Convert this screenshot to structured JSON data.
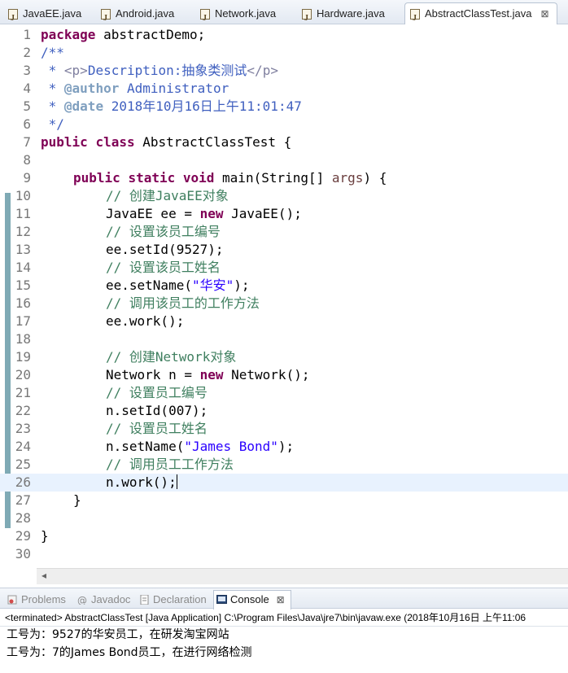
{
  "editor_tabs": [
    {
      "label": "JavaEE.java"
    },
    {
      "label": "Android.java"
    },
    {
      "label": "Network.java"
    },
    {
      "label": "Hardware.java"
    },
    {
      "label": "AbstractClassTest.java",
      "active": true
    }
  ],
  "close_glyph": "⊠",
  "code_lines": [
    "1",
    "2",
    "3",
    "4",
    "5",
    "6",
    "7",
    "8",
    "9",
    "10",
    "11",
    "12",
    "13",
    "14",
    "15",
    "16",
    "17",
    "18",
    "19",
    "20",
    "21",
    "22",
    "23",
    "24",
    "25",
    "26",
    "27",
    "28",
    "29",
    "30"
  ],
  "code": {
    "l1_kw": "package",
    "l1_rest": " abstractDemo;",
    "l2": "/**",
    "l3_pre": " * ",
    "l3_tag_open": "<p>",
    "l3_text": "Description:抽象类测试",
    "l3_tag_close": "</p>",
    "l4_pre": " * ",
    "l4_an": "@author",
    "l4_text": " Administrator",
    "l5_pre": " * ",
    "l5_an": "@date",
    "l5_text": " 2018年10月16日上午11:01:47",
    "l6": " */",
    "l7_kw1": "public",
    "l7_kw2": "class",
    "l7_rest": " AbstractClassTest {",
    "l9_kw1": "public",
    "l9_kw2": "static",
    "l9_kw3": "void",
    "l9_rest1": " main(String[] ",
    "l9_par": "args",
    "l9_rest2": ") {",
    "l10": "// 创建JavaEE对象",
    "l11_a": "JavaEE ee = ",
    "l11_kw": "new",
    "l11_b": " JavaEE();",
    "l12": "// 设置该员工编号",
    "l13": "ee.setId(9527);",
    "l14": "// 设置该员工姓名",
    "l15_a": "ee.setName(",
    "l15_str": "\"华安\"",
    "l15_b": ");",
    "l16": "// 调用该员工的工作方法",
    "l17": "ee.work();",
    "l19": "// 创建Network对象",
    "l20_a": "Network n = ",
    "l20_kw": "new",
    "l20_b": " Network();",
    "l21": "// 设置员工编号",
    "l22": "n.setId(007);",
    "l23": "// 设置员工姓名",
    "l24_a": "n.setName(",
    "l24_str": "\"James Bond\"",
    "l24_b": ");",
    "l25": "// 调用员工工作方法",
    "l26": "n.work();",
    "l27": "}",
    "l29": "}"
  },
  "panel_tabs": [
    {
      "label": "Problems",
      "icon": "problems-icon"
    },
    {
      "label": "Javadoc",
      "icon": "at-icon"
    },
    {
      "label": "Declaration",
      "icon": "declaration-icon"
    },
    {
      "label": "Console",
      "icon": "console-icon",
      "active": true
    }
  ],
  "console": {
    "header": "<terminated> AbstractClassTest [Java Application] C:\\Program Files\\Java\\jre7\\bin\\javaw.exe (2018年10月16日 上午11:06",
    "output": [
      "工号为：9527的华安员工，在研发淘宝网站",
      "工号为：7的James Bond员工，在进行网络检测"
    ]
  },
  "colors": {
    "keyword": "#7f0055",
    "comment": "#3f7f5f",
    "javadoc": "#3f5fbf",
    "string": "#2a00ff",
    "current_line": "#e8f2fe"
  }
}
